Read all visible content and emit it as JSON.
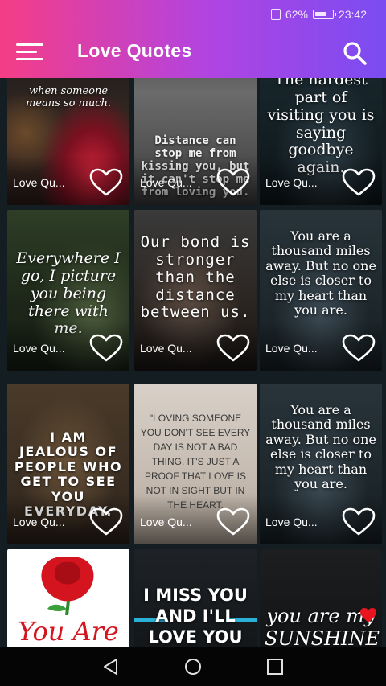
{
  "status": {
    "battery": "62%",
    "time": "23:42"
  },
  "header": {
    "title": "Love Quotes"
  },
  "colors": {
    "header_start": "#f53d86",
    "header_end": "#7a4cf1",
    "background": "#131d22"
  },
  "cards": [
    {
      "label": "Love Qu...",
      "quote": "when someone means so much."
    },
    {
      "label": "Love Qu...",
      "quote": "Distance can stop me from kissing you, but it can't stop me from loving you."
    },
    {
      "label": "Love Qu...",
      "quote": "The hardest part of visiting you is saying goodbye again."
    },
    {
      "label": "Love Qu...",
      "quote": "Everywhere I go, I picture you being there with me."
    },
    {
      "label": "Love Qu...",
      "quote": "Our bond is stronger than the distance between us."
    },
    {
      "label": "Love Qu...",
      "quote": "You are a thousand miles away. But no one else is closer to my heart than you are."
    },
    {
      "label": "Love Qu...",
      "quote": "I AM JEALOUS OF PEOPLE WHO GET TO SEE YOU EVERYDAY."
    },
    {
      "label": "Love Qu...",
      "quote": "\"LOVING SOMEONE YOU DON'T SEE EVERY DAY IS NOT A BAD THING. IT'S JUST A PROOF THAT LOVE IS NOT IN SIGHT BUT IN THE HEART."
    },
    {
      "label": "Love Qu...",
      "quote": "You are a thousand miles away. But no one else is closer to my heart than you are."
    },
    {
      "label": "",
      "quote": "You Are"
    },
    {
      "label": "",
      "quote": "I MISS YOU AND I'LL LOVE YOU"
    },
    {
      "label": "",
      "quote": "you are my SUNSHINE"
    }
  ],
  "icons": {
    "menu": "hamburger-menu-icon",
    "search": "search-icon",
    "heart": "heart-outline-icon",
    "back": "back-triangle-icon",
    "home": "home-circle-icon",
    "recents": "recents-square-icon"
  }
}
